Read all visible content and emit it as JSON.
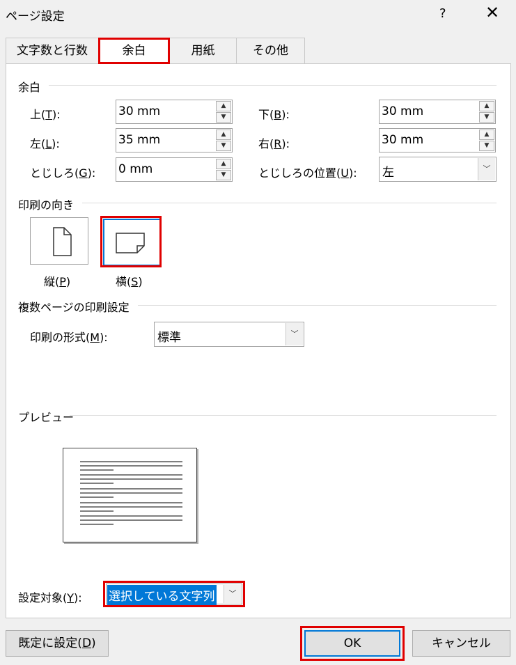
{
  "window": {
    "title": "ページ設定",
    "help_glyph": "?",
    "close_glyph": "✕"
  },
  "tabs": [
    "文字数と行数",
    "余白",
    "用紙",
    "その他"
  ],
  "margins": {
    "group_label": "余白",
    "top": {
      "label_pre": "上(",
      "key": "T",
      "label_post": "):",
      "value": "30 mm"
    },
    "bottom": {
      "label_pre": "下(",
      "key": "B",
      "label_post": "):",
      "value": "30 mm"
    },
    "left": {
      "label_pre": "左(",
      "key": "L",
      "label_post": "):",
      "value": "35 mm"
    },
    "right": {
      "label_pre": "右(",
      "key": "R",
      "label_post": "):",
      "value": "30 mm"
    },
    "gutter": {
      "label_pre": "とじしろ(",
      "key": "G",
      "label_post": "):",
      "value": "0 mm"
    },
    "gutter_pos": {
      "label_pre": "とじしろの位置(",
      "key": "U",
      "label_post": "):",
      "value": "左"
    }
  },
  "orientation": {
    "group_label": "印刷の向き",
    "portrait": {
      "label_pre": "縦(",
      "key": "P",
      "label_post": ")"
    },
    "landscape": {
      "label_pre": "横(",
      "key": "S",
      "label_post": ")"
    },
    "selected": "landscape"
  },
  "multipage": {
    "group_label": "複数ページの印刷設定",
    "format": {
      "label_pre": "印刷の形式(",
      "key": "M",
      "label_post": "):",
      "value": "標準"
    }
  },
  "preview": {
    "group_label": "プレビュー"
  },
  "apply_to": {
    "label_pre": "設定対象(",
    "key": "Y",
    "label_post": "):",
    "value": "選択している文字列"
  },
  "buttons": {
    "default": {
      "label_pre": "既定に設定(",
      "key": "D",
      "label_post": ")"
    },
    "ok": "OK",
    "cancel": "キャンセル"
  },
  "colors": {
    "highlight": "#e00000",
    "selection": "#0078d7"
  }
}
